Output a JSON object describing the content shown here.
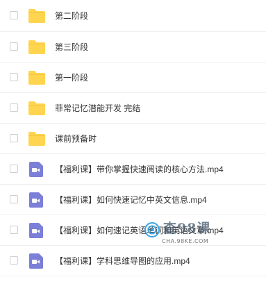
{
  "files": [
    {
      "type": "folder",
      "name": "第二阶段"
    },
    {
      "type": "folder",
      "name": "第三阶段"
    },
    {
      "type": "folder",
      "name": "第一阶段"
    },
    {
      "type": "folder",
      "name": "菲常记忆潜能开发 完结"
    },
    {
      "type": "folder",
      "name": "课前预备时"
    },
    {
      "type": "video",
      "name": "【福利课】带你掌握快速阅读的核心方法.mp4"
    },
    {
      "type": "video",
      "name": "【福利课】如何快速记忆中英文信息.mp4"
    },
    {
      "type": "video",
      "name": "【福利课】如何速记英语单词和英语文章.mp4"
    },
    {
      "type": "video",
      "name": "【福利课】学科思维导图的应用.mp4"
    }
  ],
  "icons": {
    "folder": "folder-icon",
    "video": "video-file-icon"
  },
  "colors": {
    "folder": "#FFD54F",
    "video_file": "#7B7FD8",
    "border": "#EEEEEE",
    "text": "#333333"
  },
  "watermark": {
    "title": "查98课",
    "subtitle": "CHA.98KE.COM"
  }
}
